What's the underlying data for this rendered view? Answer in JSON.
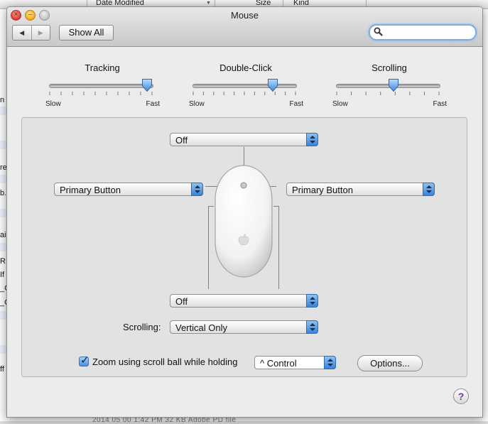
{
  "background_window": {
    "columns": [
      {
        "label": "Date Modified"
      },
      {
        "label": "Size"
      },
      {
        "label": "Kind"
      }
    ],
    "row_fragments": [
      "n",
      "re",
      "b.",
      "ai",
      "R",
      "If",
      "_C",
      "_C",
      "ff"
    ],
    "bottom_fragment": "2014 05 00 1:42 PM          32 KB       Adobe PD file"
  },
  "window": {
    "title": "Mouse",
    "show_all_label": "Show All",
    "search_placeholder": ""
  },
  "sliders": [
    {
      "title": "Tracking",
      "min_label": "Slow",
      "max_label": "Fast",
      "ticks": 10,
      "value": 0.95
    },
    {
      "title": "Double-Click",
      "min_label": "Slow",
      "max_label": "Fast",
      "ticks": 11,
      "value": 0.78
    },
    {
      "title": "Scrolling",
      "min_label": "Slow",
      "max_label": "Fast",
      "ticks": 8,
      "value": 0.56
    }
  ],
  "buttons": {
    "top": "Off",
    "left": "Primary Button",
    "right": "Primary Button",
    "bottom": "Off"
  },
  "scrolling": {
    "label": "Scrolling:",
    "value": "Vertical Only"
  },
  "zoom": {
    "checked": true,
    "label": "Zoom using scroll ball while holding",
    "modifier": "^ Control"
  },
  "options_label": "Options...",
  "help_label": "?",
  "colors": {
    "accent": "#3a82d6",
    "window_bg": "#ececec",
    "group_bg": "#e2e2e2"
  }
}
